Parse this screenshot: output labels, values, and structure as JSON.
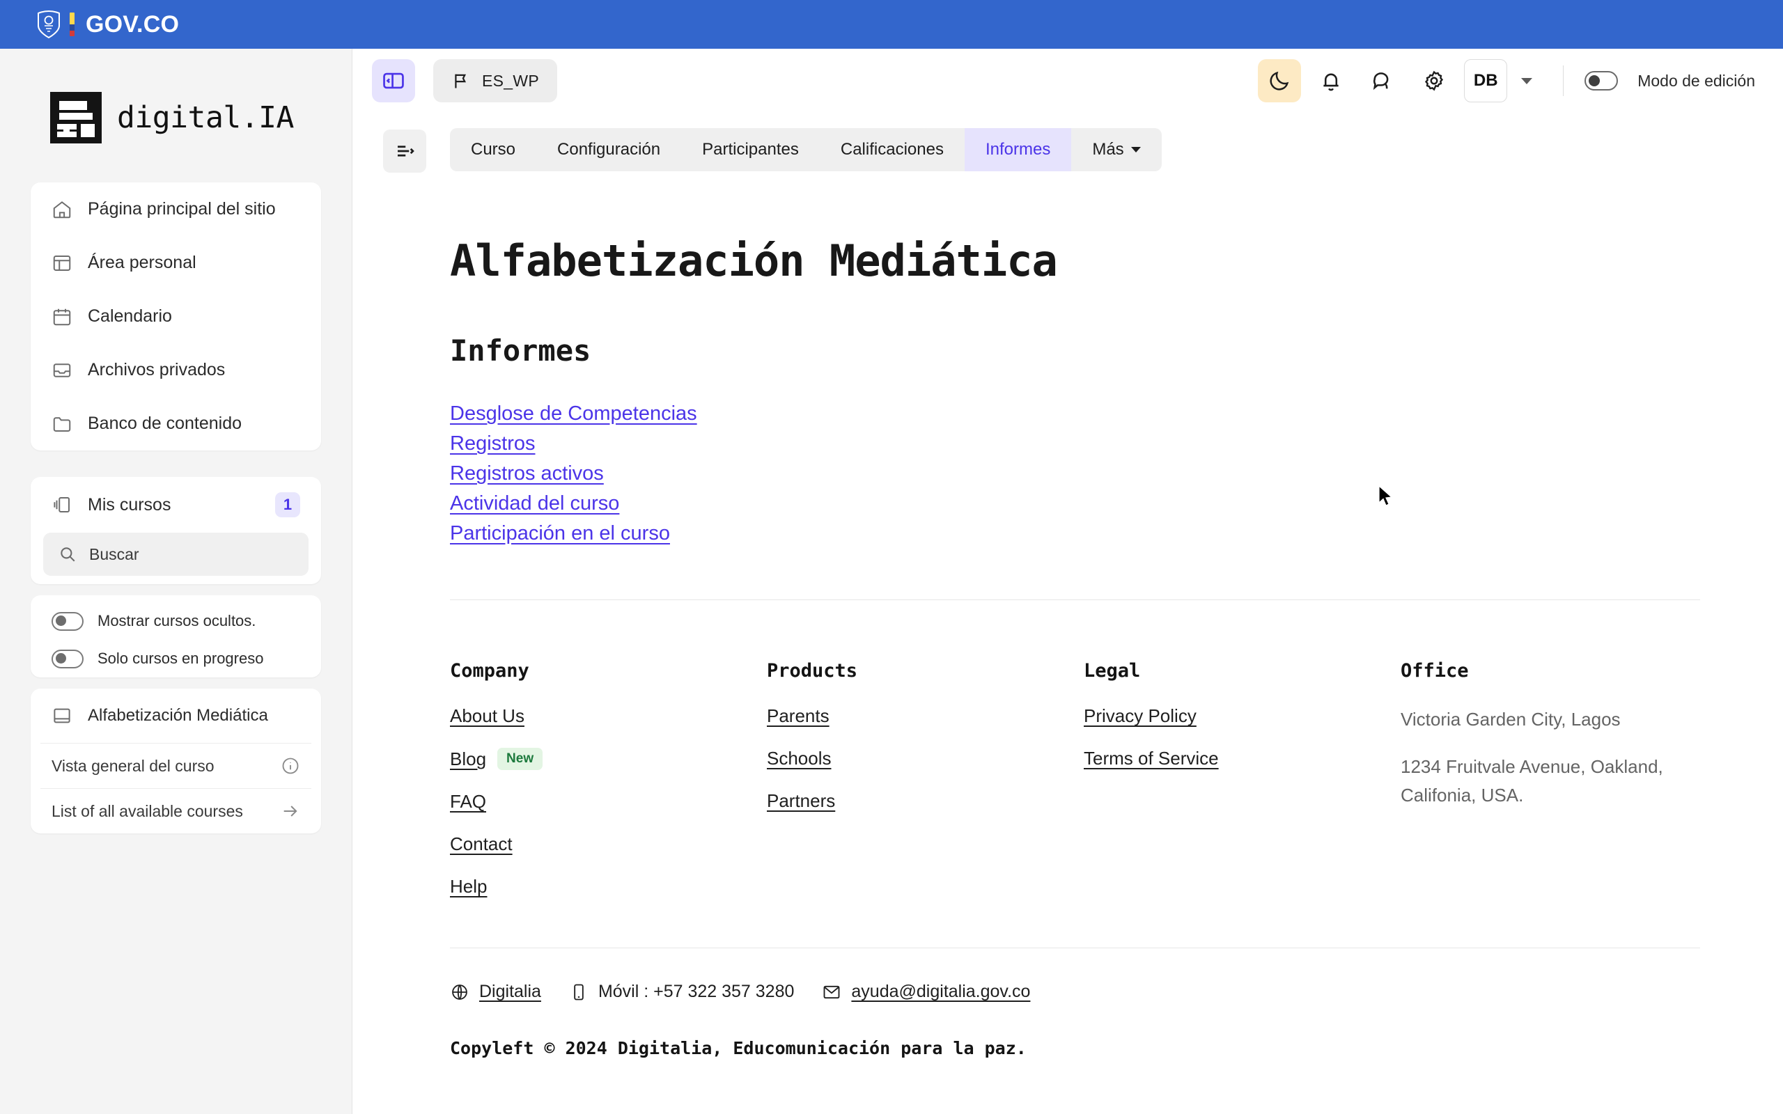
{
  "govbar": {
    "title": "GOV.CO"
  },
  "brand": {
    "name": "digital.IA"
  },
  "sidebar": {
    "nav": [
      {
        "label": "Página principal del sitio",
        "icon": "home-icon"
      },
      {
        "label": "Área personal",
        "icon": "dashboard-icon"
      },
      {
        "label": "Calendario",
        "icon": "calendar-icon"
      },
      {
        "label": "Archivos privados",
        "icon": "inbox-icon"
      },
      {
        "label": "Banco de contenido",
        "icon": "folder-icon"
      }
    ],
    "courses": {
      "title": "Mis cursos",
      "badge": "1",
      "search_placeholder": "Buscar",
      "search_value": "",
      "toggles": [
        {
          "label": "Mostrar cursos ocultos.",
          "state": "off"
        },
        {
          "label": "Solo cursos en progreso",
          "state": "off"
        }
      ],
      "items": [
        {
          "label": "Alfabetización Mediática",
          "icon": "book-icon"
        }
      ],
      "links": [
        {
          "label": "Vista general del curso",
          "icon": "info-icon"
        },
        {
          "label": "List of all available courses",
          "icon": "arrow-right-icon"
        }
      ]
    }
  },
  "topbar": {
    "sidebar_toggle": "sidebar-toggle-icon",
    "language": {
      "label": "ES_WP",
      "icon": "flag-icon"
    },
    "dark_mode_icon": "moon-icon",
    "notifications_icon": "bell-icon",
    "messages_icon": "chat-icon",
    "settings_icon": "gear-icon",
    "avatar_initials": "DB",
    "edit_mode": {
      "label": "Modo de edición",
      "state": "off"
    }
  },
  "tabs": [
    {
      "label": "Curso",
      "active": false,
      "caret": false
    },
    {
      "label": "Configuración",
      "active": false,
      "caret": false
    },
    {
      "label": "Participantes",
      "active": false,
      "caret": false
    },
    {
      "label": "Calificaciones",
      "active": false,
      "caret": false
    },
    {
      "label": "Informes",
      "active": true,
      "caret": false
    },
    {
      "label": "Más",
      "active": false,
      "caret": true
    }
  ],
  "main": {
    "page_title": "Alfabetización Mediática",
    "section_title": "Informes",
    "report_links": [
      "Desglose de Competencias",
      "Registros",
      "Registros activos",
      "Actividad del curso",
      "Participación en el curso"
    ]
  },
  "footer": {
    "columns": [
      {
        "heading": "Company",
        "links": [
          "About Us",
          "Blog",
          "FAQ",
          "Contact",
          "Help"
        ],
        "badge": "New"
      },
      {
        "heading": "Products",
        "links": [
          "Parents",
          "Schools",
          "Partners"
        ]
      },
      {
        "heading": "Legal",
        "links": [
          "Privacy Policy",
          "Terms of Service"
        ]
      },
      {
        "heading": "Office",
        "lines": [
          "Victoria Garden City, Lagos",
          "1234 Fruitvale Avenue, Oakland, Califonia, USA."
        ]
      }
    ],
    "contact": {
      "site_label": "Digitalia",
      "mobile_label": "Móvil : +57 322 357 3280",
      "email": "ayuda@digitalia.gov.co"
    },
    "copyright": "Copyleft © 2024 Digitalia, Educomunicación para la paz."
  },
  "colors": {
    "gov_blue": "#3366cc",
    "accent_purple": "#4b34e8",
    "accent_purple_bg": "#e6e3fd",
    "amber_bg": "#fdeac4",
    "badge_green_text": "#1d7a3d",
    "badge_green_bg": "#e3f5e3"
  }
}
